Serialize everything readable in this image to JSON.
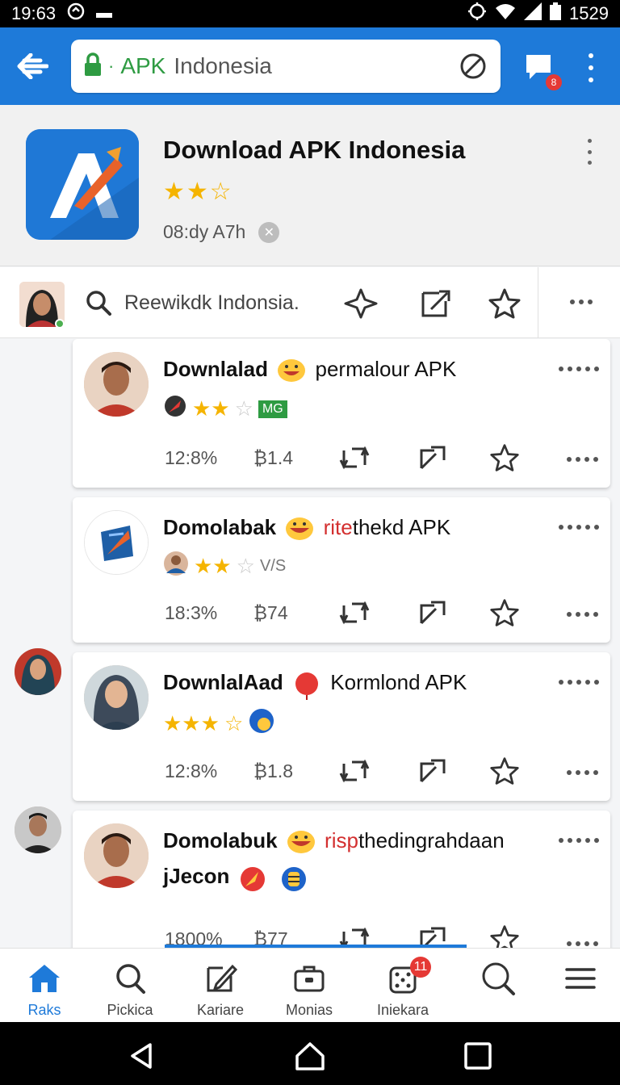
{
  "status": {
    "time": "19:63",
    "battery": "1529"
  },
  "url": {
    "accent": "APK",
    "text": "Indonesia"
  },
  "notifications": {
    "chat_badge": "8"
  },
  "app": {
    "title": "Download APK Indonesia",
    "rating": 2.5,
    "stars": "★★☆",
    "meta": "08:dy A7h"
  },
  "review_bar": {
    "search_text": "Reewikdk Indonsia."
  },
  "cards": [
    {
      "title_bold": "Downlalad",
      "title_red": "",
      "title_rest": "permalour APK",
      "stars": "★★",
      "stars_off": "☆",
      "tag": "MG",
      "percent": "12:8%",
      "count": "1.4"
    },
    {
      "title_bold": "Domolabak",
      "title_red": "rite",
      "title_rest": "thekd APK",
      "stars": "★★",
      "stars_off": "☆",
      "tag": "V/S",
      "percent": "18:3%",
      "count": "74"
    },
    {
      "title_bold": "DownlalAad",
      "title_red": "",
      "title_rest": "Kormlond APK",
      "stars": "★★★",
      "stars_off": "☆",
      "tag": "",
      "percent": "12:8%",
      "count": "1.8"
    },
    {
      "title_bold": "Domolabuk",
      "title_red": "risp",
      "title_rest": "thedingrahdaan",
      "title_line2": "jJecon",
      "percent": "1800%",
      "count": "77"
    }
  ],
  "bottom_nav": [
    {
      "label": "Raks",
      "icon": "home-icon",
      "active": true
    },
    {
      "label": "Pickica",
      "icon": "search-icon"
    },
    {
      "label": "Kariare",
      "icon": "edit-icon"
    },
    {
      "label": "Monias",
      "icon": "briefcase-icon"
    },
    {
      "label": "Iniekara",
      "icon": "dice-icon",
      "badge": "11"
    },
    {
      "label": "",
      "icon": "search-large-icon"
    },
    {
      "label": "",
      "icon": "menu-icon"
    }
  ],
  "colors": {
    "primary": "#1e7ad9",
    "star": "#f5b400",
    "accent_red": "#d32f2f",
    "url_green": "#2e9b42"
  }
}
